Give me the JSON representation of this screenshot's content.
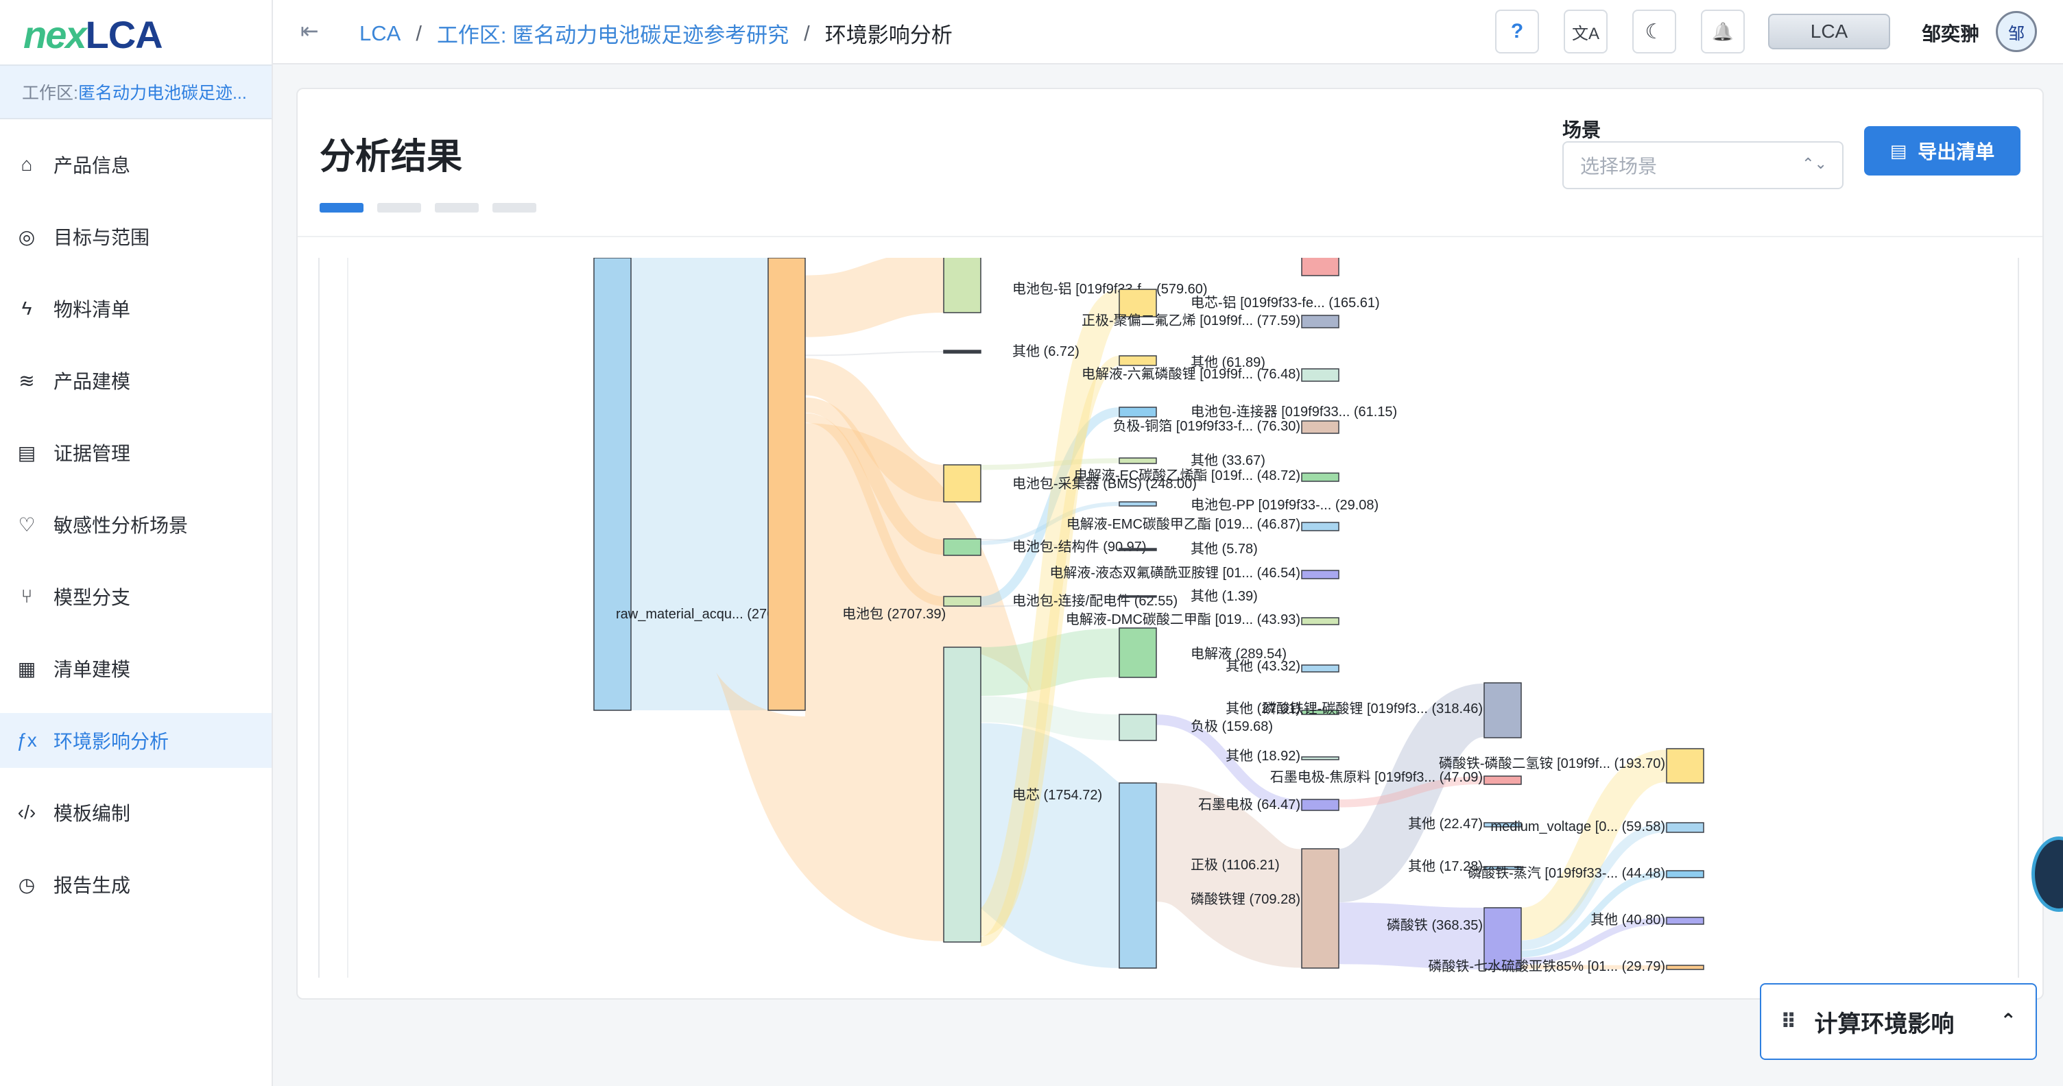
{
  "logo": {
    "part1": "nex",
    "part2": "LCA"
  },
  "workspace_banner": {
    "prefix": "工作区: ",
    "name": "匿名动力电池碳足迹..."
  },
  "sidebar": {
    "items": [
      {
        "label": "产品信息",
        "icon": "store-icon",
        "glyph": "⌂"
      },
      {
        "label": "目标与范围",
        "icon": "target-icon",
        "glyph": "◎"
      },
      {
        "label": "物料清单",
        "icon": "bolt-icon",
        "glyph": "ϟ"
      },
      {
        "label": "产品建模",
        "icon": "layers-icon",
        "glyph": "≋"
      },
      {
        "label": "证据管理",
        "icon": "document-icon",
        "glyph": "▤"
      },
      {
        "label": "敏感性分析场景",
        "icon": "heart-pulse-icon",
        "glyph": "♡"
      },
      {
        "label": "模型分支",
        "icon": "git-branch-icon",
        "glyph": "⑂"
      },
      {
        "label": "清单建模",
        "icon": "building-icon",
        "glyph": "▦"
      },
      {
        "label": "环境影响分析",
        "icon": "function-icon",
        "glyph": "ƒx"
      },
      {
        "label": "模板编制",
        "icon": "code-icon",
        "glyph": "‹/›"
      },
      {
        "label": "报告生成",
        "icon": "file-clock-icon",
        "glyph": "◷"
      }
    ],
    "active_index": 8
  },
  "header": {
    "breadcrumb": [
      "LCA",
      "工作区: 匿名动力电池碳足迹参考研究",
      "环境影响分析"
    ],
    "separator": "/",
    "help": "?",
    "translate": "文A",
    "theme": "☾",
    "bell": "🔔",
    "lca_button": "LCA",
    "user_name": "邹奕翀",
    "avatar": "邹"
  },
  "main": {
    "title": "分析结果",
    "scene_label": "场景",
    "scene_placeholder": "选择场景",
    "export_button": "导出清单",
    "steps_active": 1,
    "steps_total": 4
  },
  "chart_data": {
    "type": "sankey",
    "nodes": [
      {
        "id": "raw",
        "label": "raw_material_acqu... (2707.39)",
        "value": 2707.39,
        "color": "#a9d5f0"
      },
      {
        "id": "pack",
        "label": "电池包 (2707.39)",
        "value": 2707.39,
        "color": "#fcc98a"
      },
      {
        "id": "al",
        "label": "电池包-铝 [019f9f33-f... (579.60)",
        "value": 579.6,
        "color": "#cfe6b4"
      },
      {
        "id": "o1",
        "label": "其他 (6.72)",
        "value": 6.72,
        "color": "#3a3f47"
      },
      {
        "id": "bms",
        "label": "电池包-采集器 (BMS) (248.00)",
        "value": 248.0,
        "color": "#fde28a"
      },
      {
        "id": "struct",
        "label": "电池包-结构件 (90.97)",
        "value": 90.97,
        "color": "#9fdca8"
      },
      {
        "id": "conn",
        "label": "电池包-连接/配电件 (62.55)",
        "value": 62.55,
        "color": "#cfe6b4"
      },
      {
        "id": "cell",
        "label": "电芯 (1754.72)",
        "value": 1754.72,
        "color": "#cde9dc"
      },
      {
        "id": "cellal",
        "label": "电芯-铝 [019f9f33-fe... (165.61)",
        "value": 165.61,
        "color": "#fde28a"
      },
      {
        "id": "o2",
        "label": "其他 (61.89)",
        "value": 61.89,
        "color": "#fde28a"
      },
      {
        "id": "pconn",
        "label": "电池包-连接器 [019f9f33... (61.15)",
        "value": 61.15,
        "color": "#8fcdf0"
      },
      {
        "id": "o3",
        "label": "其他 (33.67)",
        "value": 33.67,
        "color": "#cfe6b4"
      },
      {
        "id": "pp",
        "label": "电池包-PP [019f9f33-... (29.08)",
        "value": 29.08,
        "color": "#a9d5f0"
      },
      {
        "id": "o4",
        "label": "其他 (5.78)",
        "value": 5.78,
        "color": "#3a3f47"
      },
      {
        "id": "o5",
        "label": "其他 (1.39)",
        "value": 1.39,
        "color": "#3a3f47"
      },
      {
        "id": "elyte",
        "label": "电解液 (289.54)",
        "value": 289.54,
        "color": "#9fdca8"
      },
      {
        "id": "anode",
        "label": "负极 (159.68)",
        "value": 159.68,
        "color": "#cde9dc"
      },
      {
        "id": "cathode",
        "label": "正极 (1106.21)",
        "value": 1106.21,
        "color": "#a9d5f0"
      },
      {
        "id": "pvdf",
        "label": "正极-聚偏二氟乙烯 [019f9f... (77.59)",
        "value": 77.59,
        "color": "#a9b4cc"
      },
      {
        "id": "lipf6",
        "label": "电解液-六氟磷酸锂 [019f9f... (76.48)",
        "value": 76.48,
        "color": "#cde9dc"
      },
      {
        "id": "cu",
        "label": "负极-铜箔 [019f9f33-f... (76.30)",
        "value": 76.3,
        "color": "#dfc3b4"
      },
      {
        "id": "ec",
        "label": "电解液-EC碳酸乙烯酯 [019f... (48.72)",
        "value": 48.72,
        "color": "#9fdca8"
      },
      {
        "id": "emc",
        "label": "电解液-EMC碳酸甲乙酯 [019... (46.87)",
        "value": 46.87,
        "color": "#a9d5f0"
      },
      {
        "id": "lifsi",
        "label": "电解液-液态双氟磺酰亚胺锂 [01... (46.54)",
        "value": 46.54,
        "color": "#a9a8f0"
      },
      {
        "id": "dmc",
        "label": "电解液-DMC碳酸二甲酯 [019... (43.93)",
        "value": 43.93,
        "color": "#cfe6b4"
      },
      {
        "id": "o6",
        "label": "其他 (43.32)",
        "value": 43.32,
        "color": "#a9d5f0"
      },
      {
        "id": "o7",
        "label": "其他 (27.01)",
        "value": 27.01,
        "color": "#9fdca8"
      },
      {
        "id": "o8",
        "label": "其他 (18.92)",
        "value": 18.92,
        "color": "#cde9dc"
      },
      {
        "id": "graphite_raw",
        "label": "石墨电极-焦原料 [019f9f3... (47.09)",
        "value": 47.09,
        "color": "#f4a7a7"
      },
      {
        "id": "graphite",
        "label": "石墨电极 (64.47)",
        "value": 64.47,
        "color": "#a9a8f0"
      },
      {
        "id": "lfp",
        "label": "磷酸铁锂 (709.28)",
        "value": 709.28,
        "color": "#dfc3b4"
      },
      {
        "id": "lico3",
        "label": "磷酸铁锂-碳酸锂 [019f9f3... (318.46)",
        "value": 318.46,
        "color": "#a9b4cc"
      },
      {
        "id": "o9",
        "label": "其他 (22.47)",
        "value": 22.47,
        "color": "#a9d5f0"
      },
      {
        "id": "o10",
        "label": "其他 (17.28)",
        "value": 17.28,
        "color": "#a9d5f0"
      },
      {
        "id": "fepo4",
        "label": "磷酸铁 (368.35)",
        "value": 368.35,
        "color": "#a9a8f0"
      },
      {
        "id": "map",
        "label": "磷酸铁-磷酸二氢铵 [019f9f... (193.70)",
        "value": 193.7,
        "color": "#fde28a"
      },
      {
        "id": "mv",
        "label": "medium_voltage [0... (59.58)",
        "value": 59.58,
        "color": "#a9d5f0"
      },
      {
        "id": "steam",
        "label": "磷酸铁-蒸汽 [019f9f33-... (44.48)",
        "value": 44.48,
        "color": "#8fcdf0"
      },
      {
        "id": "o11",
        "label": "其他 (40.80)",
        "value": 40.8,
        "color": "#a9a8f0"
      },
      {
        "id": "feso4",
        "label": "磷酸铁-七水硫酸亚铁85% [01... (29.79)",
        "value": 29.79,
        "color": "#fcc98a"
      },
      {
        "id": "top_cut",
        "label": "",
        "value": null,
        "color": "#f4a7a7"
      }
    ],
    "links": [
      {
        "source": "raw",
        "target": "pack",
        "value": 2707.39
      },
      {
        "source": "pack",
        "target": "al",
        "value": 579.6
      },
      {
        "source": "pack",
        "target": "o1",
        "value": 6.72
      },
      {
        "source": "pack",
        "target": "bms",
        "value": 248.0
      },
      {
        "source": "pack",
        "target": "struct",
        "value": 90.97
      },
      {
        "source": "pack",
        "target": "conn",
        "value": 62.55
      },
      {
        "source": "pack",
        "target": "cell",
        "value": 1754.72
      },
      {
        "source": "cell",
        "target": "elyte",
        "value": 289.54
      },
      {
        "source": "cell",
        "target": "anode",
        "value": 159.68
      },
      {
        "source": "cell",
        "target": "cathode",
        "value": 1106.21
      },
      {
        "source": "cathode",
        "target": "lfp",
        "value": 709.28
      },
      {
        "source": "lfp",
        "target": "lico3",
        "value": 318.46
      },
      {
        "source": "lfp",
        "target": "fepo4",
        "value": 368.35
      },
      {
        "source": "fepo4",
        "target": "map",
        "value": 193.7
      },
      {
        "source": "fepo4",
        "target": "mv",
        "value": 59.58
      },
      {
        "source": "fepo4",
        "target": "steam",
        "value": 44.48
      },
      {
        "source": "fepo4",
        "target": "o11",
        "value": 40.8
      },
      {
        "source": "fepo4",
        "target": "feso4",
        "value": 29.79
      },
      {
        "source": "anode",
        "target": "graphite",
        "value": 64.47
      },
      {
        "source": "graphite",
        "target": "graphite_raw",
        "value": 47.09
      },
      {
        "source": "conn",
        "target": "pconn",
        "value": 61.15
      },
      {
        "source": "conn",
        "target": "o5",
        "value": 1.39
      },
      {
        "source": "struct",
        "target": "o4",
        "value": 5.78
      },
      {
        "source": "struct",
        "target": "pp",
        "value": 29.08
      },
      {
        "source": "bms",
        "target": "o3",
        "value": 33.67
      },
      {
        "source": "cell",
        "target": "cellal",
        "value": 165.61
      },
      {
        "source": "cell",
        "target": "o2",
        "value": 61.89
      }
    ]
  },
  "float_panel": {
    "label": "计算环境影响",
    "drag": "⠿",
    "chevron": "⌃"
  }
}
